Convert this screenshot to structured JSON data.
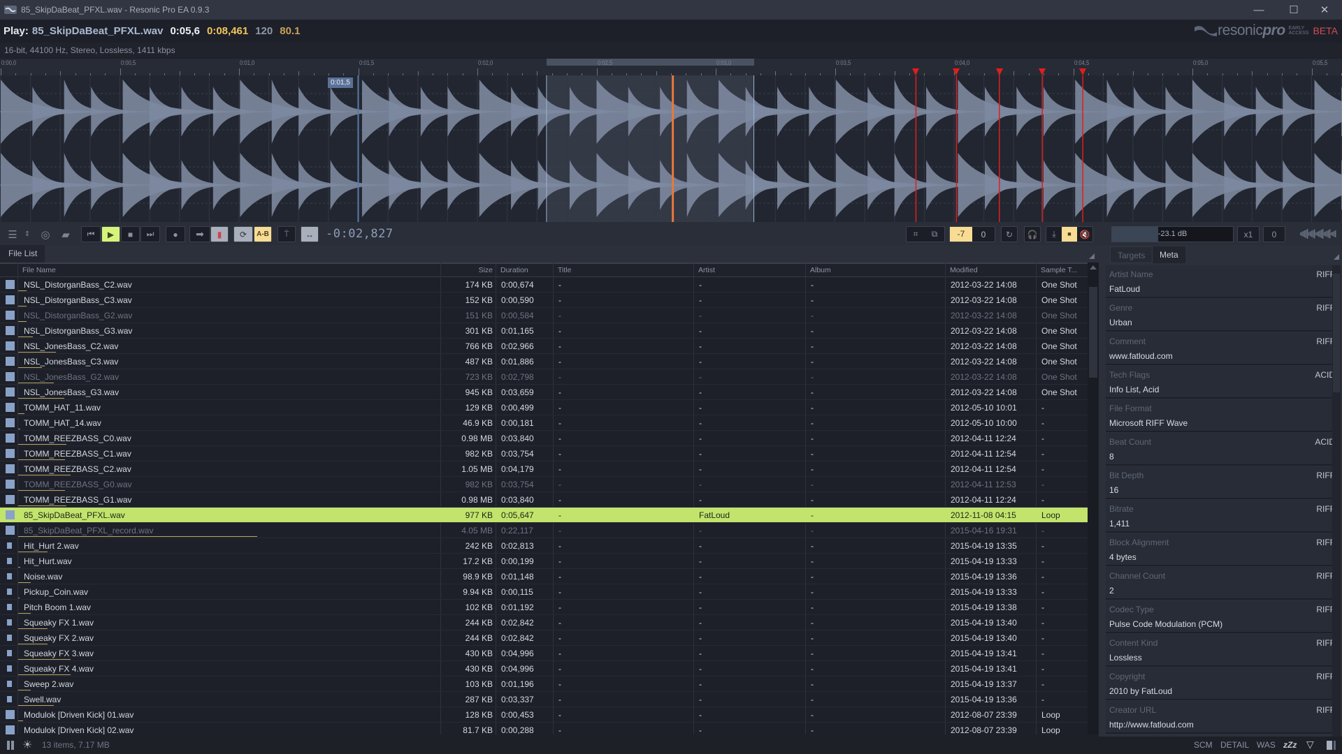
{
  "window": {
    "title": "85_SkipDaBeat_PFXL.wav - Resonic Pro EA 0.9.3",
    "controls": {
      "minimize": "—",
      "maximize": "☐",
      "close": "✕"
    }
  },
  "player": {
    "play_label": "Play:",
    "file": "85_SkipDaBeat_PFXL.wav",
    "position": "0:05,6",
    "length": "0:08,461",
    "bpm": "120",
    "alt_value": "80.1",
    "format_info": "16-bit, 44100 Hz, Stereo, Lossless, 1411 kbps"
  },
  "logo": {
    "word_a": "resonic",
    "word_b": "pro",
    "ea_line1": "EARLY",
    "ea_line2": "ACCESS",
    "beta": "BETA"
  },
  "timeline": {
    "ticks": [
      "0:00,0",
      "0:00,5",
      "0:01,0",
      "0:01,5",
      "0:02,0",
      "0:02,5",
      "0:03,0",
      "0:03,5",
      "0:04,0",
      "0:04,5",
      "0:05,0",
      "0:05,5"
    ],
    "hover_time": "0:01,5",
    "duration_s": 5.647,
    "selection_s": [
      2.29,
      3.16
    ],
    "playhead_s": 2.82,
    "cursor_s": 1.5,
    "markers_s": [
      3.84,
      4.01,
      4.19,
      4.37,
      4.54
    ],
    "colors": {
      "wave": "#7d8aa0",
      "selection": "#343946",
      "playhead": "#e8793a",
      "marker": "#e01e1e",
      "cursor": "#5a7aa8"
    }
  },
  "toolbar": {
    "time_readout": "-0:02,827",
    "ab_label": "A-B",
    "pitch_value": "-7",
    "pitch_fine": "0",
    "gain_db": "-23.1 dB",
    "gain_level": 0.38,
    "speed": "x1",
    "offset": "0"
  },
  "file_panel": {
    "tab_label": "File List",
    "columns": [
      "File Name",
      "Size",
      "Duration",
      "Title",
      "Artist",
      "Album",
      "Modified",
      "Sample T..."
    ],
    "rows": [
      {
        "name": "NSL_DistorganBass_C2.wav",
        "size": "174 KB",
        "duration": "0:00,674",
        "title": "-",
        "artist": "-",
        "album": "-",
        "modified": "2012-03-22 14:08",
        "type": "One Shot",
        "dim": false,
        "small": false,
        "bar": 0.02
      },
      {
        "name": "NSL_DistorganBass_C3.wav",
        "size": "152 KB",
        "duration": "0:00,590",
        "title": "-",
        "artist": "-",
        "album": "-",
        "modified": "2012-03-22 14:08",
        "type": "One Shot",
        "dim": false,
        "small": false,
        "bar": 0.02
      },
      {
        "name": "NSL_DistorganBass_G2.wav",
        "size": "151 KB",
        "duration": "0:00,584",
        "title": "-",
        "artist": "-",
        "album": "-",
        "modified": "2012-03-22 14:08",
        "type": "One Shot",
        "dim": true,
        "small": false,
        "bar": 0.02
      },
      {
        "name": "NSL_DistorganBass_G3.wav",
        "size": "301 KB",
        "duration": "0:01,165",
        "title": "-",
        "artist": "-",
        "album": "-",
        "modified": "2012-03-22 14:08",
        "type": "One Shot",
        "dim": false,
        "small": false,
        "bar": 0.035
      },
      {
        "name": "NSL_JonesBass_C2.wav",
        "size": "766 KB",
        "duration": "0:02,966",
        "title": "-",
        "artist": "-",
        "album": "-",
        "modified": "2012-03-22 14:08",
        "type": "One Shot",
        "dim": false,
        "small": false,
        "bar": 0.09
      },
      {
        "name": "NSL_JonesBass_C3.wav",
        "size": "487 KB",
        "duration": "0:01,886",
        "title": "-",
        "artist": "-",
        "album": "-",
        "modified": "2012-03-22 14:08",
        "type": "One Shot",
        "dim": false,
        "small": false,
        "bar": 0.057
      },
      {
        "name": "NSL_JonesBass_G2.wav",
        "size": "723 KB",
        "duration": "0:02,798",
        "title": "-",
        "artist": "-",
        "album": "-",
        "modified": "2012-03-22 14:08",
        "type": "One Shot",
        "dim": true,
        "small": false,
        "bar": 0.085
      },
      {
        "name": "NSL_JonesBass_G3.wav",
        "size": "945 KB",
        "duration": "0:03,659",
        "title": "-",
        "artist": "-",
        "album": "-",
        "modified": "2012-03-22 14:08",
        "type": "One Shot",
        "dim": false,
        "small": false,
        "bar": 0.11
      },
      {
        "name": "TOMM_HAT_11.wav",
        "size": "129 KB",
        "duration": "0:00,499",
        "title": "-",
        "artist": "-",
        "album": "-",
        "modified": "2012-05-10 10:01",
        "type": "-",
        "dim": false,
        "small": false,
        "bar": 0.015
      },
      {
        "name": "TOMM_HAT_14.wav",
        "size": "46.9 KB",
        "duration": "0:00,181",
        "title": "-",
        "artist": "-",
        "album": "-",
        "modified": "2012-05-10 10:00",
        "type": "-",
        "dim": false,
        "small": false,
        "bar": 0.005
      },
      {
        "name": "TOMM_REEZBASS_C0.wav",
        "size": "0.98 MB",
        "duration": "0:03,840",
        "title": "-",
        "artist": "-",
        "album": "-",
        "modified": "2012-04-11 12:24",
        "type": "-",
        "dim": false,
        "small": false,
        "bar": 0.115
      },
      {
        "name": "TOMM_REEZBASS_C1.wav",
        "size": "982 KB",
        "duration": "0:03,754",
        "title": "-",
        "artist": "-",
        "album": "-",
        "modified": "2012-04-11 12:54",
        "type": "-",
        "dim": false,
        "small": false,
        "bar": 0.112
      },
      {
        "name": "TOMM_REEZBASS_C2.wav",
        "size": "1.05 MB",
        "duration": "0:04,179",
        "title": "-",
        "artist": "-",
        "album": "-",
        "modified": "2012-04-11 12:54",
        "type": "-",
        "dim": false,
        "small": false,
        "bar": 0.125
      },
      {
        "name": "TOMM_REEZBASS_G0.wav",
        "size": "982 KB",
        "duration": "0:03,754",
        "title": "-",
        "artist": "-",
        "album": "-",
        "modified": "2012-04-11 12:53",
        "type": "-",
        "dim": true,
        "small": false,
        "bar": 0.112
      },
      {
        "name": "TOMM_REEZBASS_G1.wav",
        "size": "0.98 MB",
        "duration": "0:03,840",
        "title": "-",
        "artist": "-",
        "album": "-",
        "modified": "2012-04-11 12:24",
        "type": "-",
        "dim": false,
        "small": false,
        "bar": 0.115
      },
      {
        "name": "85_SkipDaBeat_PFXL.wav",
        "size": "977 KB",
        "duration": "0:05,647",
        "title": "-",
        "artist": "FatLoud",
        "album": "-",
        "modified": "2012-11-08 04:15",
        "type": "Loop",
        "dim": false,
        "small": false,
        "bar": 0.17,
        "selected": true
      },
      {
        "name": "85_SkipDaBeat_PFXL_record.wav",
        "size": "4.05 MB",
        "duration": "0:22,117",
        "title": "-",
        "artist": "-",
        "album": "-",
        "modified": "2015-04-16 19:31",
        "type": "-",
        "dim": true,
        "small": false,
        "bar": 0.57
      },
      {
        "name": "Hit_Hurt 2.wav",
        "size": "242 KB",
        "duration": "0:02,813",
        "title": "-",
        "artist": "-",
        "album": "-",
        "modified": "2015-04-19 13:35",
        "type": "-",
        "dim": false,
        "small": true,
        "bar": 0.07
      },
      {
        "name": "Hit_Hurt.wav",
        "size": "17.2 KB",
        "duration": "0:00,199",
        "title": "-",
        "artist": "-",
        "album": "-",
        "modified": "2015-04-19 13:33",
        "type": "-",
        "dim": false,
        "small": true,
        "bar": 0.005
      },
      {
        "name": "Noise.wav",
        "size": "98.9 KB",
        "duration": "0:01,148",
        "title": "-",
        "artist": "-",
        "album": "-",
        "modified": "2015-04-19 13:36",
        "type": "-",
        "dim": false,
        "small": true,
        "bar": 0.03
      },
      {
        "name": "Pickup_Coin.wav",
        "size": "9.94 KB",
        "duration": "0:00,115",
        "title": "-",
        "artist": "-",
        "album": "-",
        "modified": "2015-04-19 13:33",
        "type": "-",
        "dim": false,
        "small": true,
        "bar": 0.002
      },
      {
        "name": "Pitch Boom 1.wav",
        "size": "102 KB",
        "duration": "0:01,192",
        "title": "-",
        "artist": "-",
        "album": "-",
        "modified": "2015-04-19 13:38",
        "type": "-",
        "dim": false,
        "small": true,
        "bar": 0.03
      },
      {
        "name": "Squeaky FX 1.wav",
        "size": "244 KB",
        "duration": "0:02,842",
        "title": "-",
        "artist": "-",
        "album": "-",
        "modified": "2015-04-19 13:40",
        "type": "-",
        "dim": false,
        "small": true,
        "bar": 0.07
      },
      {
        "name": "Squeaky FX 2.wav",
        "size": "244 KB",
        "duration": "0:02,842",
        "title": "-",
        "artist": "-",
        "album": "-",
        "modified": "2015-04-19 13:40",
        "type": "-",
        "dim": false,
        "small": true,
        "bar": 0.07
      },
      {
        "name": "Squeaky FX 3.wav",
        "size": "430 KB",
        "duration": "0:04,996",
        "title": "-",
        "artist": "-",
        "album": "-",
        "modified": "2015-04-19 13:41",
        "type": "-",
        "dim": false,
        "small": true,
        "bar": 0.125
      },
      {
        "name": "Squeaky FX 4.wav",
        "size": "430 KB",
        "duration": "0:04,996",
        "title": "-",
        "artist": "-",
        "album": "-",
        "modified": "2015-04-19 13:41",
        "type": "-",
        "dim": false,
        "small": true,
        "bar": 0.125
      },
      {
        "name": "Sweep 2.wav",
        "size": "103 KB",
        "duration": "0:01,196",
        "title": "-",
        "artist": "-",
        "album": "-",
        "modified": "2015-04-19 13:37",
        "type": "-",
        "dim": false,
        "small": true,
        "bar": 0.03
      },
      {
        "name": "Swell.wav",
        "size": "287 KB",
        "duration": "0:03,337",
        "title": "-",
        "artist": "-",
        "album": "-",
        "modified": "2015-04-19 13:36",
        "type": "-",
        "dim": false,
        "small": true,
        "bar": 0.085
      },
      {
        "name": "Modulok [Driven Kick] 01.wav",
        "size": "128 KB",
        "duration": "0:00,453",
        "title": "-",
        "artist": "-",
        "album": "-",
        "modified": "2012-08-07 23:39",
        "type": "Loop",
        "dim": false,
        "small": false,
        "bar": 0.012
      },
      {
        "name": "Modulok [Driven Kick] 02.wav",
        "size": "81.7 KB",
        "duration": "0:00,288",
        "title": "-",
        "artist": "-",
        "album": "-",
        "modified": "2012-08-07 23:39",
        "type": "Loop",
        "dim": false,
        "small": false,
        "bar": 0.008
      }
    ]
  },
  "meta_panel": {
    "tabs": [
      "Targets",
      "Meta"
    ],
    "active_tab": "Meta",
    "items": [
      {
        "key": "Artist Name",
        "source": "RIFF",
        "value": "FatLoud"
      },
      {
        "key": "Genre",
        "source": "RIFF",
        "value": "Urban"
      },
      {
        "key": "Comment",
        "source": "RIFF",
        "value": "www.fatloud.com"
      },
      {
        "key": "Tech Flags",
        "source": "ACID",
        "value": "Info List, Acid"
      },
      {
        "key": "File Format",
        "source": "",
        "value": "Microsoft RIFF Wave"
      },
      {
        "key": "Beat Count",
        "source": "ACID",
        "value": "8"
      },
      {
        "key": "Bit Depth",
        "source": "RIFF",
        "value": "16"
      },
      {
        "key": "Bitrate",
        "source": "RIFF",
        "value": "1,411"
      },
      {
        "key": "Block Alignment",
        "source": "RIFF",
        "value": "4 bytes"
      },
      {
        "key": "Channel Count",
        "source": "RIFF",
        "value": "2"
      },
      {
        "key": "Codec Type",
        "source": "RIFF",
        "value": "Pulse Code Modulation (PCM)"
      },
      {
        "key": "Content Kind",
        "source": "RIFF",
        "value": "Lossless"
      },
      {
        "key": "Copyright",
        "source": "RIFF",
        "value": "2010 by FatLoud"
      },
      {
        "key": "Creator URL",
        "source": "RIFF",
        "value": "http://www.fatloud.com"
      }
    ]
  },
  "status": {
    "summary": "13 items, 7.17 MB",
    "scm": "SCM",
    "detail": "DETAIL",
    "was": "WAS",
    "sleep": "zZz"
  }
}
